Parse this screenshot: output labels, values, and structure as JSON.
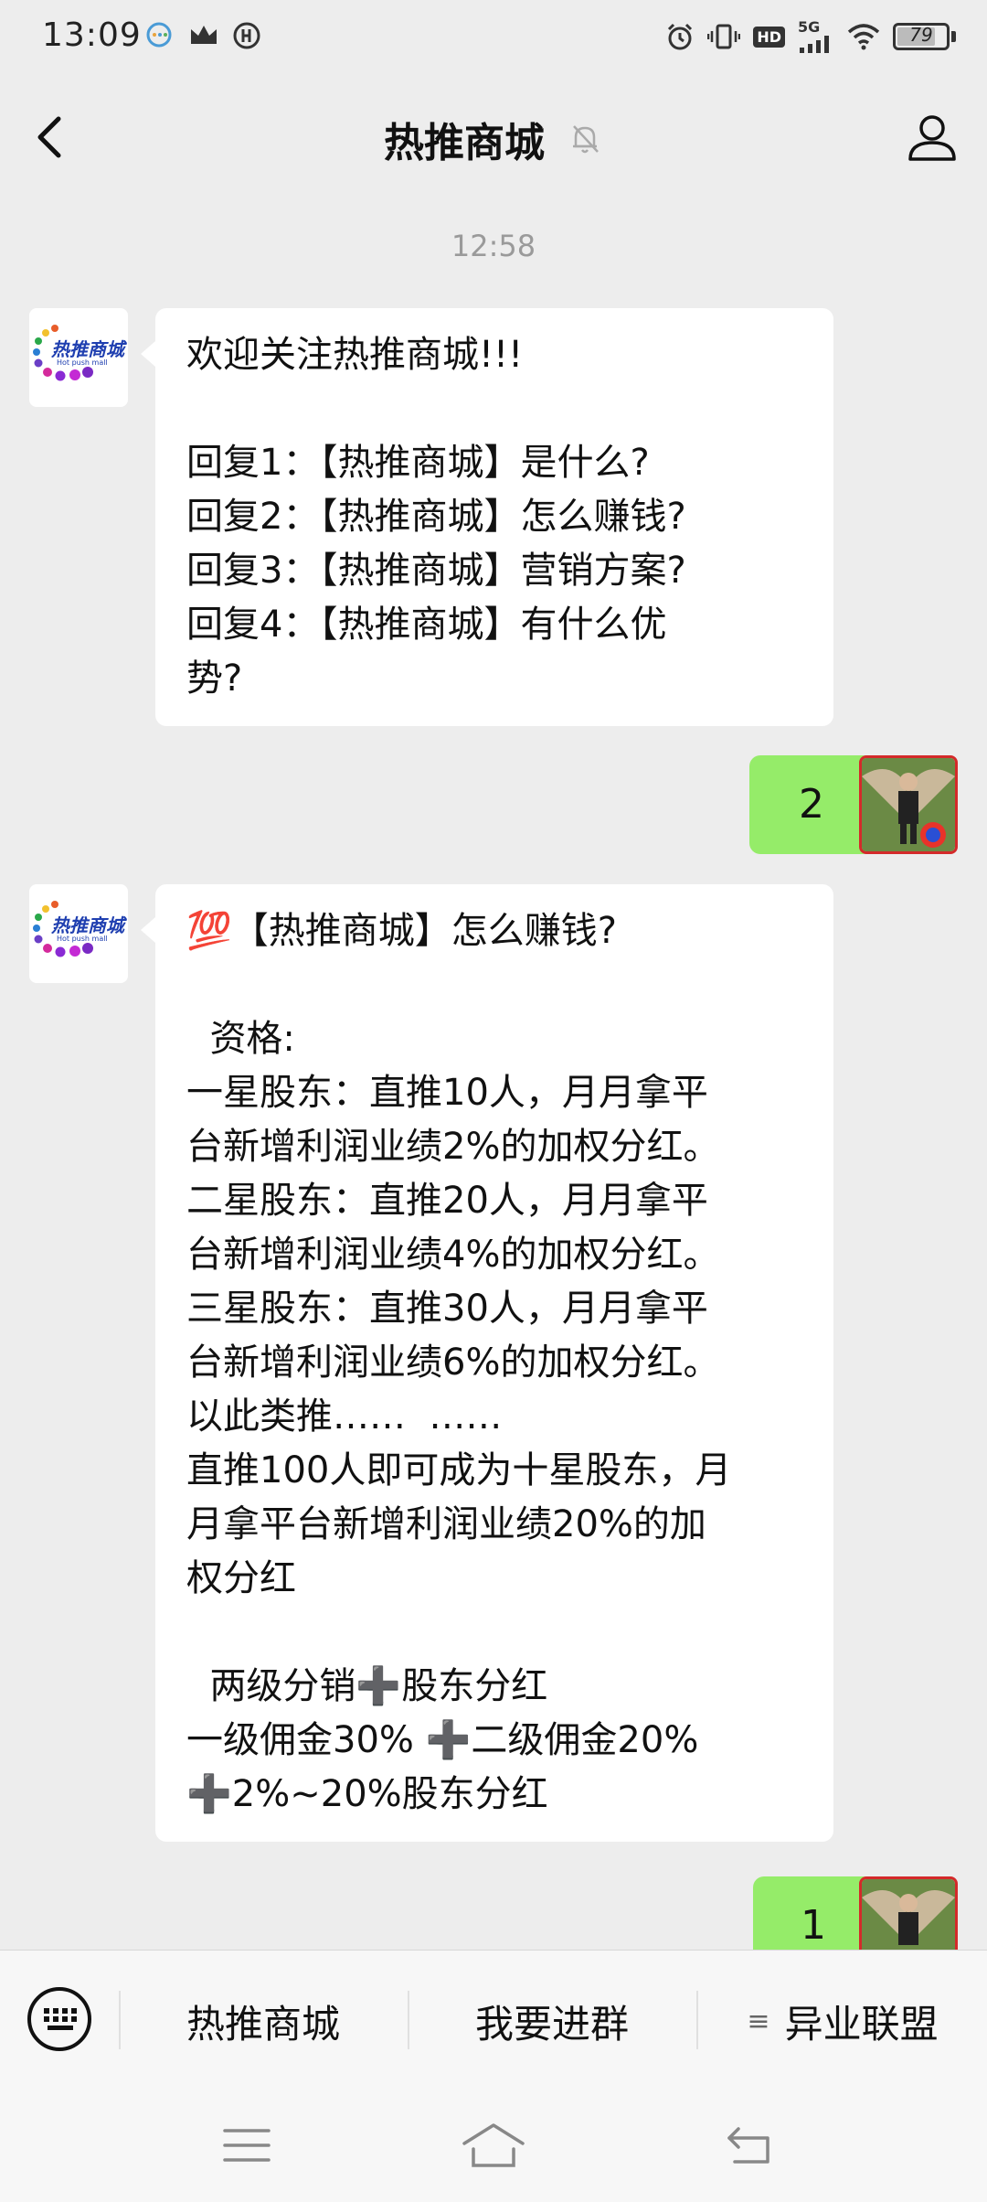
{
  "status_bar": {
    "time": "13:09",
    "network": "5G",
    "hd": "HD",
    "battery": "79",
    "battery_level": 0.79
  },
  "header": {
    "title": "热推商城",
    "back_icon": "chevron-left-icon",
    "mute_icon": "bell-off-icon",
    "profile_icon": "person-icon"
  },
  "chat": {
    "timestamp": "12:58",
    "logo_text": "热推商城",
    "logo_subtext": "Hot push mall",
    "messages": [
      {
        "from": "account",
        "lines": [
          "欢迎关注热推商城!!!",
          "",
          "回复1：【热推商城】是什么?",
          "回复2：【热推商城】怎么赚钱?",
          "回复3：【热推商城】营销方案?",
          "回复4：【热推商城】有什么优",
          "势?"
        ]
      },
      {
        "from": "user",
        "text": "2"
      },
      {
        "from": "account",
        "lines": [
          "💯【热推商城】怎么赚钱?",
          "",
          "  资格:",
          "一星股东：直推10人，月月拿平",
          "台新增利润业绩2%的加权分红。",
          "二星股东：直推20人，月月拿平",
          "台新增利润业绩4%的加权分红。",
          "三星股东：直推30人，月月拿平",
          "台新增利润业绩6%的加权分红。",
          "以此类推……  ……",
          "直推100人即可成为十星股东，月",
          "月拿平台新增利润业绩20%的加",
          "权分红",
          "",
          "  两级分销➕股东分红",
          "一级佣金30% ➕二级佣金20%",
          "➕2%~20%股东分红"
        ]
      },
      {
        "from": "user",
        "text": "1"
      }
    ]
  },
  "menu": {
    "keyboard_icon": "keyboard-icon",
    "items": [
      "热推商城",
      "我要进群",
      "异业联盟"
    ],
    "submenu_icon": "≡"
  },
  "nav": {
    "menu_icon": "menu-icon",
    "home_icon": "home-icon",
    "back_icon": "back-icon"
  }
}
